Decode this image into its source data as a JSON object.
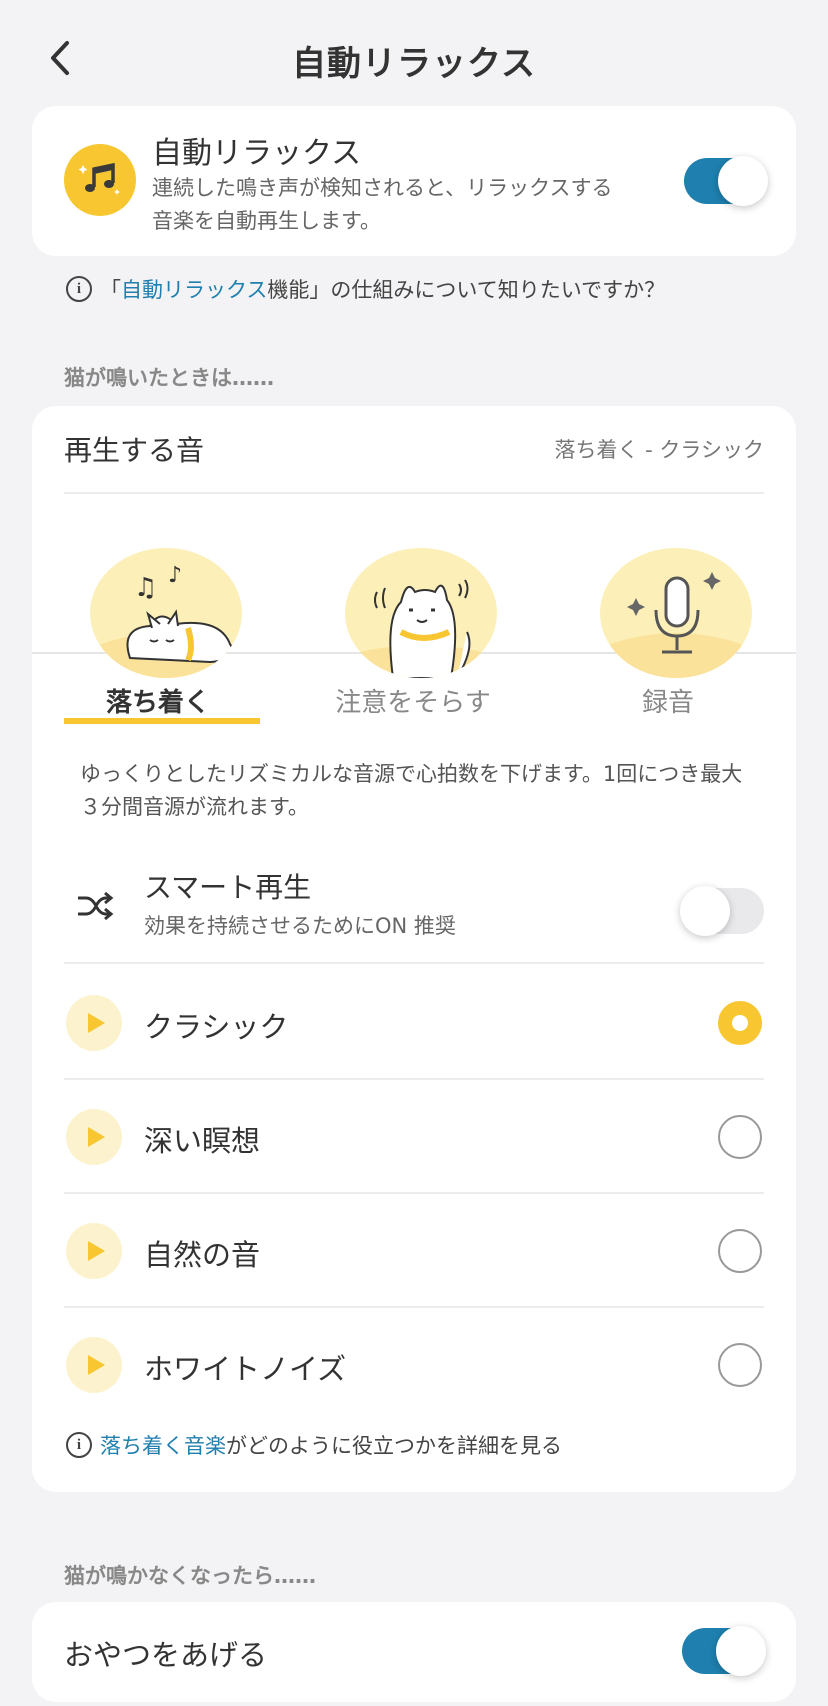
{
  "header": {
    "title": "自動リラックス"
  },
  "auto_relax": {
    "title": "自動リラックス",
    "description": "連続した鳴き声が検知されると、リラックスする音楽を自動再生します。",
    "enabled": true,
    "icon": "music-notes-icon"
  },
  "info_question": {
    "prefix": "「",
    "link": "自動リラックス",
    "suffix": "機能」の仕組みについて知りたいですか？"
  },
  "section_when_meowing": "猫が鳴いたときは……",
  "sound": {
    "label": "再生する音",
    "value": "落ち着く - クラシック"
  },
  "tabs": [
    {
      "label": "落ち着く",
      "active": true,
      "icon": "sleeping-cat-icon"
    },
    {
      "label": "注意をそらす",
      "active": false,
      "icon": "waving-cat-icon"
    },
    {
      "label": "録音",
      "active": false,
      "icon": "microphone-icon"
    }
  ],
  "tab_description": "ゆっくりとしたリズミカルな音源で心拍数を下げます。1回につき最大３分間音源が流れます。",
  "smart_play": {
    "title": "スマート再生",
    "subtitle": "効果を持続させるためにON 推奨",
    "enabled": false,
    "icon": "shuffle-icon"
  },
  "options": [
    {
      "name": "クラシック",
      "selected": true
    },
    {
      "name": "深い瞑想",
      "selected": false
    },
    {
      "name": "自然の音",
      "selected": false
    },
    {
      "name": "ホワイトノイズ",
      "selected": false
    }
  ],
  "info_more": {
    "link": "落ち着く音楽",
    "suffix": "がどのように役立つかを詳細を見る"
  },
  "section_when_stopped": "猫が鳴かなくなったら……",
  "treat": {
    "label": "おやつをあげる",
    "enabled": true
  },
  "colors": {
    "accent": "#f7c631",
    "toggle_on": "#1f7fae",
    "link": "#1f7fae"
  }
}
